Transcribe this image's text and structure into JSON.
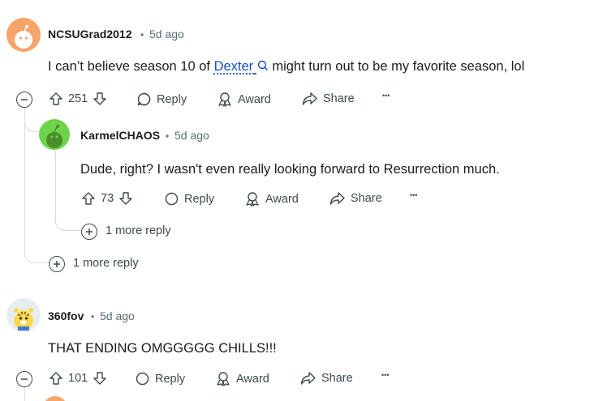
{
  "comments": [
    {
      "username": "NCSUGrad2012",
      "separator": "•",
      "age": "5d ago",
      "text_before": "I can’t believe season 10 of ",
      "link": "Dexter",
      "text_after": " might turn out to be my favorite season, lol",
      "score": "251",
      "reply_label": "Reply",
      "award_label": "Award",
      "share_label": "Share",
      "more_label": "•••",
      "more_replies": "1 more reply"
    },
    {
      "username": "KarmelCHAOS",
      "separator": "•",
      "age": "5d ago",
      "text": "Dude, right? I wasn't even really looking forward to Resurrection much.",
      "score": "73",
      "reply_label": "Reply",
      "award_label": "Award",
      "share_label": "Share",
      "more_label": "•••",
      "more_replies": "1 more reply"
    },
    {
      "username": "360fov",
      "separator": "•",
      "age": "5d ago",
      "text": "THAT ENDING OMGGGGG CHILLS!!!",
      "score": "101",
      "reply_label": "Reply",
      "award_label": "Award",
      "share_label": "Share",
      "more_label": "•••"
    }
  ],
  "colors": {
    "link": "#0f4fc4",
    "meta": "#576f76",
    "action": "#3c4a4e",
    "thread_line": "#d6dcde",
    "avatar_orange": "#f7a46b",
    "avatar_green": "#6ed34a"
  },
  "icons": [
    "snoo-avatar",
    "search-icon",
    "collapse-icon",
    "upvote-icon",
    "downvote-icon",
    "reply-icon",
    "award-icon",
    "share-icon",
    "more-options-icon",
    "expand-icon"
  ]
}
